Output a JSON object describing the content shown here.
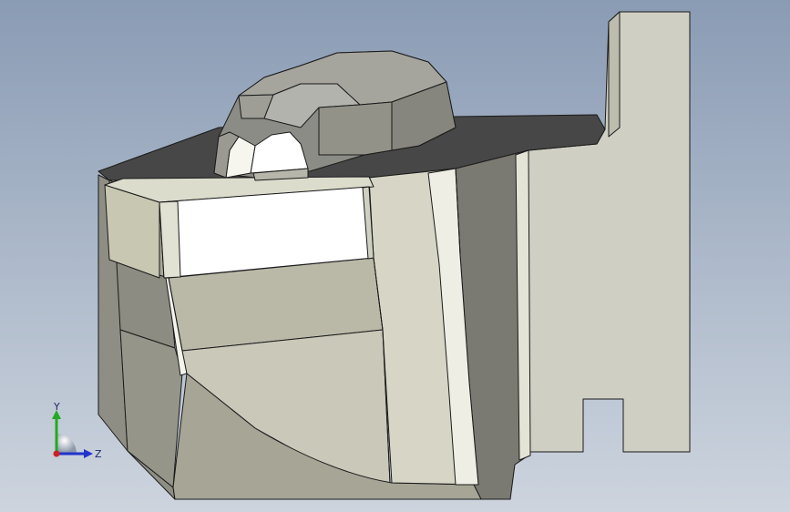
{
  "viewport": {
    "background_top": "#8a9bb4",
    "background_bottom": "#cdd4de"
  },
  "model": {
    "face_light": "#d9d8c9",
    "face_mid": "#b8b7a5",
    "face_dark": "#7f7f76",
    "face_highlight": "#ffffff",
    "top_surface": "#4a4a4a",
    "edge_color": "#1a1a1a"
  },
  "triad": {
    "y_label": "Y",
    "z_label": "Z",
    "y_color": "#22aa22",
    "z_color": "#2233cc",
    "x_color": "#cc2222"
  }
}
